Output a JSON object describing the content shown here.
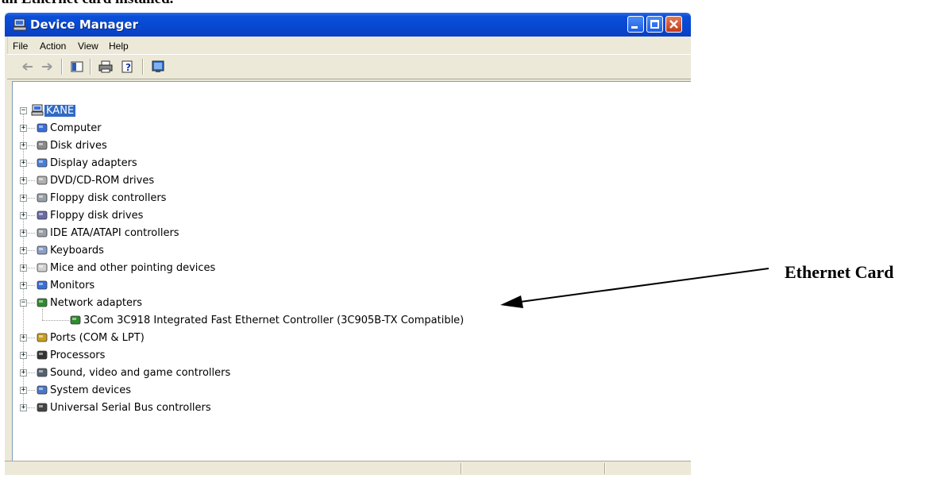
{
  "doc": {
    "heading": "an Ethernet card installed."
  },
  "window": {
    "title": "Device Manager",
    "controls": [
      "minimize-icon",
      "maximize-icon",
      "close-icon"
    ]
  },
  "menu": [
    "File",
    "Action",
    "View",
    "Help"
  ],
  "toolbar": {
    "buttons": [
      "back-arrow-icon",
      "forward-arrow-icon",
      "show-hide-tree-icon",
      "print-icon",
      "properties-help-icon",
      "scan-hardware-icon"
    ]
  },
  "tree": {
    "root": "KANE",
    "items": [
      {
        "label": "Computer",
        "icon": "computer-icon",
        "expanded": false
      },
      {
        "label": "Disk drives",
        "icon": "disk-drive-icon",
        "expanded": false
      },
      {
        "label": "Display adapters",
        "icon": "display-adapter-icon",
        "expanded": false
      },
      {
        "label": "DVD/CD-ROM drives",
        "icon": "cdrom-icon",
        "expanded": false
      },
      {
        "label": "Floppy disk controllers",
        "icon": "controller-icon",
        "expanded": false
      },
      {
        "label": "Floppy disk drives",
        "icon": "floppy-icon",
        "expanded": false
      },
      {
        "label": "IDE ATA/ATAPI controllers",
        "icon": "controller-icon",
        "expanded": false
      },
      {
        "label": "Keyboards",
        "icon": "keyboard-icon",
        "expanded": false
      },
      {
        "label": "Mice and other pointing devices",
        "icon": "mouse-icon",
        "expanded": false
      },
      {
        "label": "Monitors",
        "icon": "monitor-icon",
        "expanded": false
      },
      {
        "label": "Network adapters",
        "icon": "network-card-icon",
        "expanded": true,
        "children": [
          {
            "label": "3Com 3C918 Integrated Fast Ethernet Controller (3C905B-TX Compatible)",
            "icon": "network-card-icon"
          }
        ]
      },
      {
        "label": "Ports (COM & LPT)",
        "icon": "port-icon",
        "expanded": false
      },
      {
        "label": "Processors",
        "icon": "processor-icon",
        "expanded": false
      },
      {
        "label": "Sound, video and game controllers",
        "icon": "sound-icon",
        "expanded": false
      },
      {
        "label": "System devices",
        "icon": "system-icon",
        "expanded": false
      },
      {
        "label": "Universal Serial Bus controllers",
        "icon": "usb-icon",
        "expanded": false
      }
    ]
  },
  "annotation": {
    "label": "Ethernet Card"
  },
  "colors": {
    "titlebar": "#0a4fd8",
    "selection": "#316ac5",
    "chrome": "#ece9d8"
  }
}
